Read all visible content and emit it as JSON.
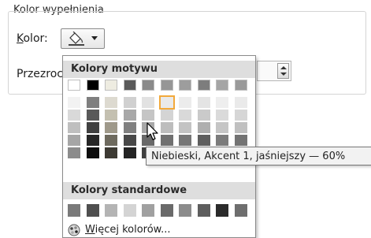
{
  "dialog": {
    "group_title": "Kolor wypełnienia",
    "kolor_label_accel": "K",
    "kolor_label_rest": "olor:",
    "przezroczystosc_label": "Przezroczystość:"
  },
  "color_button": {
    "icon": "paint-bucket-icon",
    "caret": "chevron-down-icon"
  },
  "palette": {
    "theme_header": "Kolory motywu",
    "standard_header": "Kolory standardowe",
    "more_colors_accel": "W",
    "more_colors_rest": "ięcej kolorów...",
    "more_colors_icon": "color-wheel-icon",
    "theme_columns": [
      [
        "#ffffff",
        "#f2f2f2",
        "#d9d9d9",
        "#bfbfbf",
        "#a6a6a6",
        "#8c8c8c"
      ],
      [
        "#000000",
        "#7f7f7f",
        "#595959",
        "#404040",
        "#262626",
        "#0d0d0d"
      ],
      [
        "#eeece1",
        "#dddad0",
        "#c4c0b0",
        "#9f998a",
        "#6e6a5e",
        "#3d3a33"
      ],
      [
        "#5a5a5a",
        "#d0d0d0",
        "#a8a8a8",
        "#808080",
        "#484848",
        "#242424"
      ],
      [
        "#8a8a8a",
        "#e2e2e2",
        "#c5c5c5",
        "#a8a8a8",
        "#696969",
        "#3e3e3e"
      ],
      [
        "#969696",
        "#eaeaea",
        "#d4d4d4",
        "#bdbdbd",
        "#707070",
        "#454545"
      ],
      [
        "#9d9d9d",
        "#ececec",
        "#d9d9d9",
        "#c3c3c3",
        "#767676",
        "#4a4a4a"
      ],
      [
        "#7d7d7d",
        "#e4e4e4",
        "#cacaca",
        "#afafaf",
        "#5e5e5e",
        "#383838"
      ],
      [
        "#a5a5a5",
        "#eeeeee",
        "#dadada",
        "#c5c5c5",
        "#7b7b7b",
        "#525252"
      ],
      [
        "#9a9a9a",
        "#eaeaea",
        "#d6d6d6",
        "#c0c0c0",
        "#737373",
        "#474747"
      ]
    ],
    "standard_colors": [
      "#7a7a7a",
      "#4f4f4f",
      "#b4b4b4",
      "#d4d4d4",
      "#a0a0a0",
      "#6a6a6a",
      "#8c8c8c",
      "#5e5e5e",
      "#2b2b2b",
      "#6e6e6e"
    ],
    "selected": "theme-col-5-shade-1"
  },
  "tooltip": {
    "text": "Niebieski, Akcent 1, jaśniejszy — 60%"
  }
}
